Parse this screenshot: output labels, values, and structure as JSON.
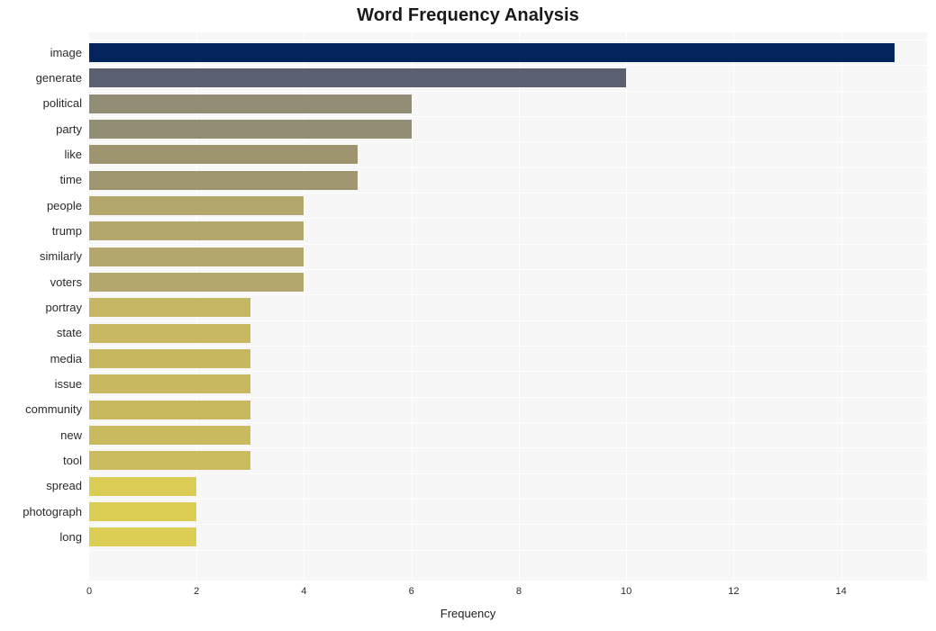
{
  "chart_data": {
    "type": "bar",
    "orientation": "horizontal",
    "title": "Word Frequency Analysis",
    "xlabel": "Frequency",
    "ylabel": "",
    "categories": [
      "image",
      "generate",
      "political",
      "party",
      "like",
      "time",
      "people",
      "trump",
      "similarly",
      "voters",
      "portray",
      "state",
      "media",
      "issue",
      "community",
      "new",
      "tool",
      "spread",
      "photograph",
      "long"
    ],
    "values": [
      15,
      10,
      6,
      6,
      5,
      5,
      4,
      4,
      4,
      4,
      3,
      3,
      3,
      3,
      3,
      3,
      3,
      2,
      2,
      2
    ],
    "bar_colors": [
      "#03245c",
      "#5b6070",
      "#918e75",
      "#928e74",
      "#9e9570",
      "#9f9670",
      "#b3a76d",
      "#b3a76d",
      "#b3a76d",
      "#b3a76d",
      "#c4b663",
      "#c7b861",
      "#c7b860",
      "#c8b960",
      "#c8b95f",
      "#c9ba5f",
      "#c9bb5e",
      "#dbcc56",
      "#dccd55",
      "#dccd55"
    ],
    "xticks": [
      0,
      2,
      4,
      6,
      8,
      10,
      12,
      14
    ],
    "xlim": [
      0,
      15.6
    ],
    "grid": true,
    "grid_color": "#ffffff",
    "plot_background": "#f7f7f7",
    "figure_background": "#ffffff",
    "legend": null
  }
}
